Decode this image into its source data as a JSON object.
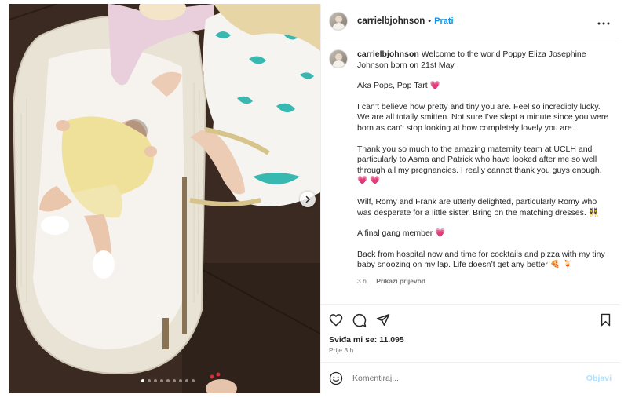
{
  "header": {
    "username": "carrielbjohnson",
    "separator": "•",
    "follow_label": "Prati",
    "more_icon": "more-icon"
  },
  "caption": {
    "username": "carrielbjohnson",
    "paragraphs": [
      "Welcome to the world Poppy Eliza Josephine Johnson born on 21st May.",
      "Aka Pops, Pop Tart 💗",
      "I can’t believe how pretty and tiny you are. Feel so incredibly lucky. We are all totally smitten. Not sure I’ve slept a minute since you were born as can’t stop looking at how completely lovely you are.",
      "Thank you so much to the amazing maternity team at UCLH and particularly to Asma and Patrick who have looked after me so well through all my pregnancies. I really cannot thank you guys enough. 💗 💗",
      "Wilf, Romy and Frank are utterly delighted, particularly Romy who was desperate for a little sister. Bring on the matching dresses. 👯‍♀️",
      "A final gang member 💗",
      "Back from hospital now and time for cocktails and pizza with my tiny baby snoozing on my lap. Life doesn’t get any better 🍕 🍹"
    ],
    "age": "3 h",
    "translate_label": "Prikaži prijevod"
  },
  "actions": {
    "like_icon": "heart-icon",
    "comment_icon": "comment-icon",
    "share_icon": "share-icon",
    "save_icon": "bookmark-icon"
  },
  "likes_text": "Sviđa mi se: 11.095",
  "posted_ago": "Prije 3 h",
  "comment": {
    "placeholder": "Komentiraj...",
    "post_label": "Objavi",
    "emoji_icon": "emoji-icon"
  },
  "carousel": {
    "slide_count": 9,
    "active_index": 0,
    "next_icon": "chevron-right-icon"
  }
}
